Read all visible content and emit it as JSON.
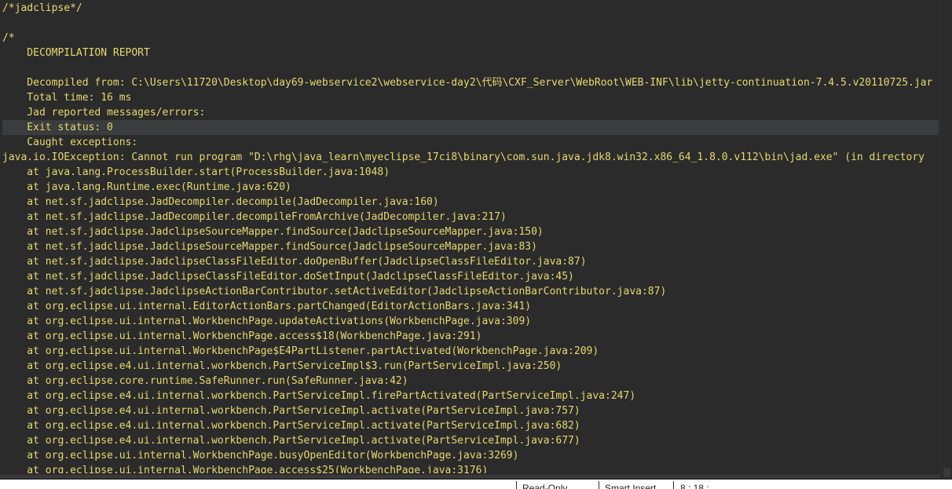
{
  "editor": {
    "current_line_index": 8,
    "lines": [
      "/*jadclipse*/",
      "",
      "/*",
      "    DECOMPILATION REPORT",
      "",
      "    Decompiled from: C:\\Users\\11720\\Desktop\\day69-webservice2\\webservice-day2\\代码\\CXF_Server\\WebRoot\\WEB-INF\\lib\\jetty-continuation-7.4.5.v20110725.jar",
      "    Total time: 16 ms",
      "    Jad reported messages/errors:",
      "    Exit status: 0",
      "    Caught exceptions:",
      "java.io.IOException: Cannot run program \"D:\\rhg\\java_learn\\myeclipse_17ci8\\binary\\com.sun.java.jdk8.win32.x86_64_1.8.0.v112\\bin\\jad.exe\" (in directory",
      "    at java.lang.ProcessBuilder.start(ProcessBuilder.java:1048)",
      "    at java.lang.Runtime.exec(Runtime.java:620)",
      "    at net.sf.jadclipse.JadDecompiler.decompile(JadDecompiler.java:160)",
      "    at net.sf.jadclipse.JadDecompiler.decompileFromArchive(JadDecompiler.java:217)",
      "    at net.sf.jadclipse.JadclipseSourceMapper.findSource(JadclipseSourceMapper.java:150)",
      "    at net.sf.jadclipse.JadclipseSourceMapper.findSource(JadclipseSourceMapper.java:83)",
      "    at net.sf.jadclipse.JadclipseClassFileEditor.doOpenBuffer(JadclipseClassFileEditor.java:87)",
      "    at net.sf.jadclipse.JadclipseClassFileEditor.doSetInput(JadclipseClassFileEditor.java:45)",
      "    at net.sf.jadclipse.JadclipseActionBarContributor.setActiveEditor(JadclipseActionBarContributor.java:87)",
      "    at org.eclipse.ui.internal.EditorActionBars.partChanged(EditorActionBars.java:341)",
      "    at org.eclipse.ui.internal.WorkbenchPage.updateActivations(WorkbenchPage.java:309)",
      "    at org.eclipse.ui.internal.WorkbenchPage.access$18(WorkbenchPage.java:291)",
      "    at org.eclipse.ui.internal.WorkbenchPage$E4PartListener.partActivated(WorkbenchPage.java:209)",
      "    at org.eclipse.e4.ui.internal.workbench.PartServiceImpl$3.run(PartServiceImpl.java:250)",
      "    at org.eclipse.core.runtime.SafeRunner.run(SafeRunner.java:42)",
      "    at org.eclipse.e4.ui.internal.workbench.PartServiceImpl.firePartActivated(PartServiceImpl.java:247)",
      "    at org.eclipse.e4.ui.internal.workbench.PartServiceImpl.activate(PartServiceImpl.java:757)",
      "    at org.eclipse.e4.ui.internal.workbench.PartServiceImpl.activate(PartServiceImpl.java:682)",
      "    at org.eclipse.e4.ui.internal.workbench.PartServiceImpl.activate(PartServiceImpl.java:677)",
      "    at org.eclipse.ui.internal.WorkbenchPage.busyOpenEditor(WorkbenchPage.java:3269)",
      "    at org.eclipse.ui.internal.WorkbenchPage.access$25(WorkbenchPage.java:3176)"
    ]
  },
  "status_bar": {
    "fields": [
      "Read-Only",
      "Smart Insert",
      "8 : 18 : ..."
    ]
  },
  "colors": {
    "editor_background": "#2b2b2b",
    "text": "#e6d86f",
    "current_line_highlight": "#3b3c3d",
    "status_background": "#ffffff"
  }
}
